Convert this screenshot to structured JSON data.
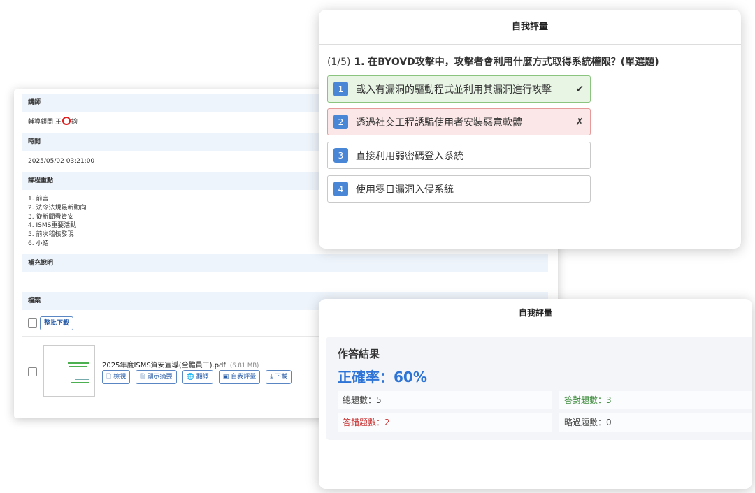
{
  "course": {
    "instructor_header": "講師",
    "instructor_prefix": "輔導顧問 王",
    "instructor_suffix": "鈞",
    "time_header": "時間",
    "time_value": "2025/05/02 03:21:00",
    "outline_header": "課程重點",
    "outline": [
      "1. 前言",
      "2. 法令法規最新動向",
      "3. 從新聞看資安",
      "4. ISMS重要活動",
      "5. 前次稽核發現",
      "6. 小結"
    ],
    "notes_header": "補充說明",
    "files_header": "檔案",
    "bulk_download_label": "整批下載",
    "file": {
      "name": "2025年度ISMS資安宣導(全體員工).pdf",
      "size": "(6.81 MB)",
      "actions": [
        {
          "icon": "file-view-icon",
          "glyph": "🗋",
          "label": "檢視"
        },
        {
          "icon": "summary-icon",
          "glyph": "🗎",
          "label": "顯示摘要"
        },
        {
          "icon": "globe-icon",
          "glyph": "🌐",
          "label": "翻譯"
        },
        {
          "icon": "quiz-icon",
          "glyph": "▣",
          "label": "自我評量"
        },
        {
          "icon": "download-icon",
          "glyph": "⤓",
          "label": "下載"
        }
      ]
    }
  },
  "quiz": {
    "title": "自我評量",
    "progress": "(1/5)",
    "question": "1. 在BYOVD攻擊中，攻擊者會利用什麼方式取得系統權限？(單選題)",
    "options": [
      {
        "num": "1",
        "text": "載入有漏洞的驅動程式並利用其漏洞進行攻擊",
        "state": "correct",
        "mark": "✔"
      },
      {
        "num": "2",
        "text": "透過社交工程誘騙使用者安裝惡意軟體",
        "state": "wrong",
        "mark": "✗"
      },
      {
        "num": "3",
        "text": "直接利用弱密碼登入系統",
        "state": "none",
        "mark": ""
      },
      {
        "num": "4",
        "text": "使用零日漏洞入侵系統",
        "state": "none",
        "mark": ""
      }
    ],
    "colors": {
      "correct_bg": "#e8f5e5",
      "wrong_bg": "#fbe7e7",
      "number_badge": "#4a86d6"
    }
  },
  "result": {
    "title": "自我評量",
    "heading": "作答結果",
    "accuracy": "正確率：60%",
    "total": "總題數：5",
    "correct": "答對題數：3",
    "wrong": "答錯題數：2",
    "skipped": "略過題數：0",
    "colors": {
      "accuracy": "#2d74d6",
      "correct": "#3c8c3c",
      "wrong": "#c83232"
    }
  }
}
